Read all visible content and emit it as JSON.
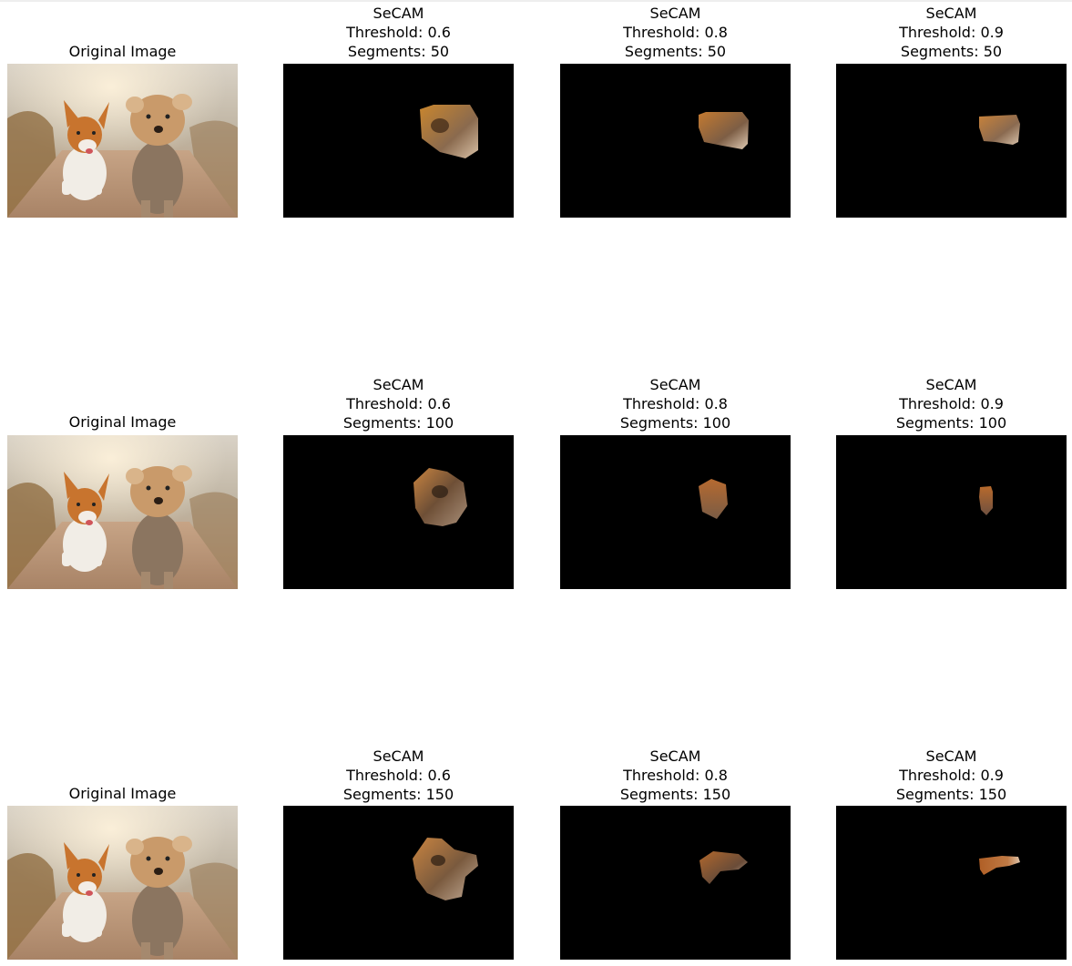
{
  "rows": [
    {
      "original_title": "Original Image",
      "secam": [
        {
          "line1": "SeCAM",
          "line2": "Threshold: 0.6",
          "line3": "Segments: 50"
        },
        {
          "line1": "SeCAM",
          "line2": "Threshold: 0.8",
          "line3": "Segments: 50"
        },
        {
          "line1": "SeCAM",
          "line2": "Threshold: 0.9",
          "line3": "Segments: 50"
        }
      ]
    },
    {
      "original_title": "Original Image",
      "secam": [
        {
          "line1": "SeCAM",
          "line2": "Threshold: 0.6",
          "line3": "Segments: 100"
        },
        {
          "line1": "SeCAM",
          "line2": "Threshold: 0.8",
          "line3": "Segments: 100"
        },
        {
          "line1": "SeCAM",
          "line2": "Threshold: 0.9",
          "line3": "Segments: 100"
        }
      ]
    },
    {
      "original_title": "Original Image",
      "secam": [
        {
          "line1": "SeCAM",
          "line2": "Threshold: 0.6",
          "line3": "Segments: 150"
        },
        {
          "line1": "SeCAM",
          "line2": "Threshold: 0.8",
          "line3": "Segments: 150"
        },
        {
          "line1": "SeCAM",
          "line2": "Threshold: 0.9",
          "line3": "Segments: 150"
        }
      ]
    }
  ],
  "colors": {
    "mask_background": "#000000",
    "fur_light": "#c99a6a",
    "fur_dark": "#6b4a2e",
    "corgi_orange": "#c8742e",
    "sky": "#cfc6b9",
    "path": "#c9a88a"
  }
}
